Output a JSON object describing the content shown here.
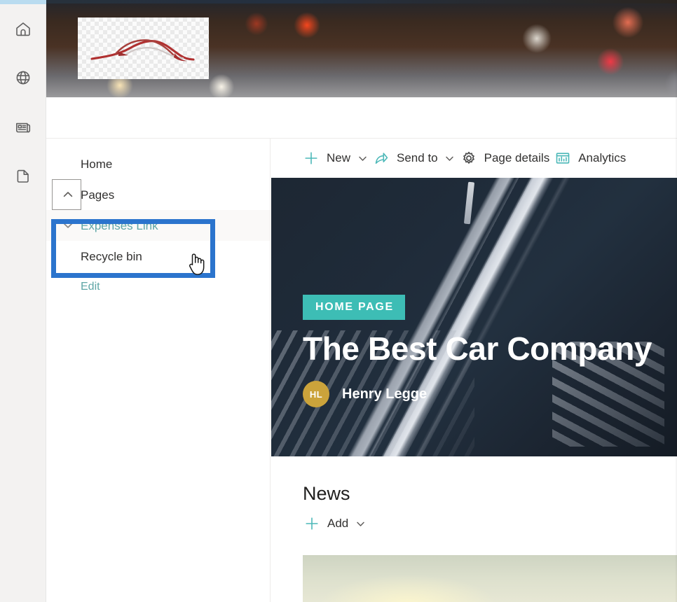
{
  "app_rail": {
    "items": [
      {
        "name": "home",
        "icon": "home-icon"
      },
      {
        "name": "globe",
        "icon": "globe-icon"
      },
      {
        "name": "news",
        "icon": "news-icon"
      },
      {
        "name": "document",
        "icon": "document-icon"
      }
    ]
  },
  "banner": {
    "logo_alt": "car-logo",
    "accent": "#ff481e"
  },
  "site_nav": {
    "items": [
      {
        "label": "Home",
        "has_chevron": false,
        "active": false
      },
      {
        "label": "Pages",
        "has_chevron": true,
        "chevron": "up",
        "active": false,
        "focused": true
      },
      {
        "label": "Expenses Link",
        "has_chevron": true,
        "chevron": "down",
        "active": true
      },
      {
        "label": "Recycle bin",
        "has_chevron": false,
        "active": false
      }
    ],
    "edit_label": "Edit",
    "highlight_color": "#2b74cd"
  },
  "command_bar": {
    "items": [
      {
        "label": "New",
        "icon": "plus-icon",
        "has_caret": true
      },
      {
        "label": "Send to",
        "icon": "send-to-icon",
        "has_caret": true
      },
      {
        "label": "Page details",
        "icon": "gear-icon",
        "has_caret": false
      },
      {
        "label": "Analytics",
        "icon": "analytics-icon",
        "has_caret": false
      }
    ]
  },
  "hero": {
    "badge": "HOME PAGE",
    "title": "The Best Car Company",
    "author_initials": "HL",
    "author_name": "Henry Legge",
    "badge_color": "#3dbdb5",
    "avatar_color": "#cba33b"
  },
  "news": {
    "heading": "News",
    "add_label": "Add"
  }
}
